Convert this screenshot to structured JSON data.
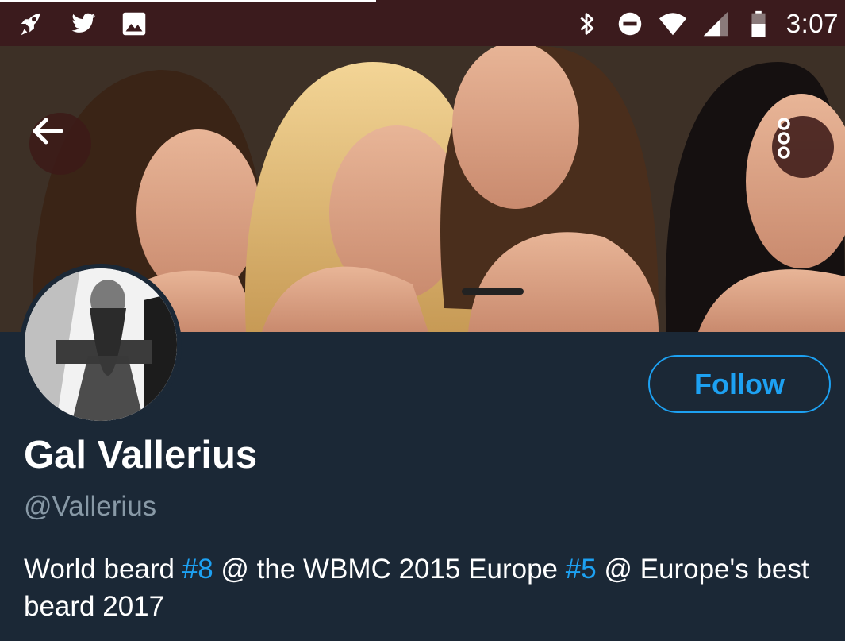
{
  "status_bar": {
    "left_icons": [
      "rocket-icon",
      "twitter-bird-icon",
      "image-icon"
    ],
    "right_icons": [
      "bluetooth-icon",
      "do-not-disturb-icon",
      "wifi-icon",
      "cell-signal-icon",
      "battery-icon"
    ],
    "time": "3:07"
  },
  "header": {
    "banner_image": "header-photo",
    "back_icon": "arrow-back-icon",
    "more_icon": "more-vertical-icon"
  },
  "profile": {
    "avatar": "profile-avatar",
    "follow_label": "Follow",
    "display_name": "Gal Vallerius",
    "handle": "@Vallerius",
    "bio": {
      "part1": "World beard ",
      "hashtag1": "#8",
      "part2": " @ the WBMC 2015 Europe ",
      "hashtag2": "#5",
      "part3": " @ Europe's best beard 2017"
    }
  },
  "colors": {
    "status_bar_bg": "#3b1b1d",
    "page_bg": "#1b2836",
    "accent": "#1da1f2",
    "secondary_text": "#8899a6"
  }
}
